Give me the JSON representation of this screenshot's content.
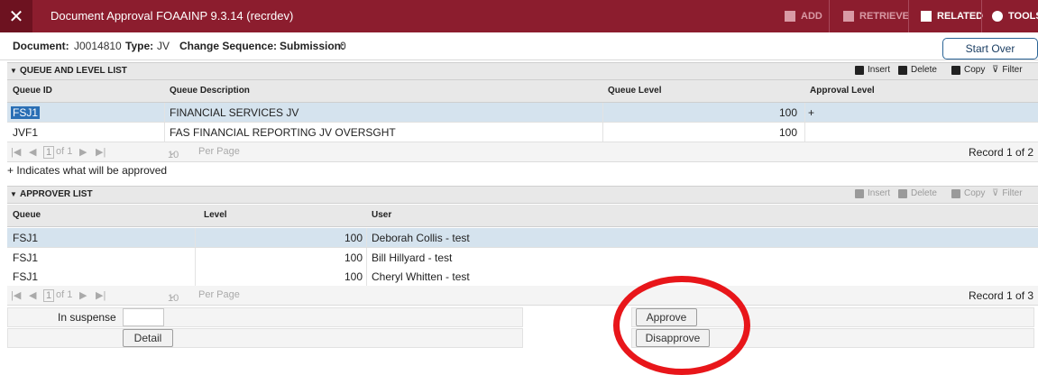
{
  "titlebar": {
    "close_symbol": "✕",
    "title": "Document Approval FOAAINP 9.3.14 (recrdev)",
    "add": "ADD",
    "retrieve": "RETRIEVE",
    "related": "RELATED",
    "tools": "TOOLS"
  },
  "document": {
    "document_label": "Document:",
    "document_value": "J0014810",
    "type_label": "Type:",
    "type_value": "JV",
    "change_sequence_label": "Change Sequence:",
    "submission_label": "Submission:",
    "submission_value": "0",
    "start_over": "Start Over"
  },
  "queue_section": {
    "title": "QUEUE AND LEVEL LIST",
    "toolbar": {
      "insert": "Insert",
      "delete": "Delete",
      "copy": "Copy",
      "filter": "Filter"
    },
    "columns": [
      "Queue ID",
      "Queue Description",
      "Queue Level",
      "Approval Level"
    ],
    "rows": [
      {
        "queue_id": "FSJ1",
        "description": "FINANCIAL SERVICES JV",
        "level": "100",
        "approval": "+"
      },
      {
        "queue_id": "JVF1",
        "description": "FAS FINANCIAL REPORTING JV OVERSGHT",
        "level": "100",
        "approval": ""
      }
    ],
    "pager": {
      "page": "1",
      "of": "of 1",
      "per_page_value": "10",
      "per_page": "Per Page",
      "record": "Record 1 of 2"
    },
    "note": "+ Indicates what will be approved"
  },
  "approver_section": {
    "title": "APPROVER LIST",
    "toolbar": {
      "insert": "Insert",
      "delete": "Delete",
      "copy": "Copy",
      "filter": "Filter"
    },
    "columns": [
      "Queue",
      "Level",
      "User"
    ],
    "rows": [
      {
        "queue": "FSJ1",
        "level": "100",
        "user": "Deborah Collis - test"
      },
      {
        "queue": "FSJ1",
        "level": "100",
        "user": "Bill Hillyard - test"
      },
      {
        "queue": "FSJ1",
        "level": "100",
        "user": "Cheryl Whitten - test"
      }
    ],
    "pager": {
      "page": "1",
      "of": "of 1",
      "per_page_value": "10",
      "per_page": "Per Page",
      "record": "Record 1 of 3"
    }
  },
  "actions": {
    "in_suspense_label": "In suspense",
    "in_suspense_value": "",
    "detail": "Detail",
    "approve": "Approve",
    "disapprove": "Disapprove"
  },
  "colors": {
    "titlebar": "#8c1d2e",
    "selected_row": "#d5e3ee",
    "annotation": "#e8161a"
  }
}
